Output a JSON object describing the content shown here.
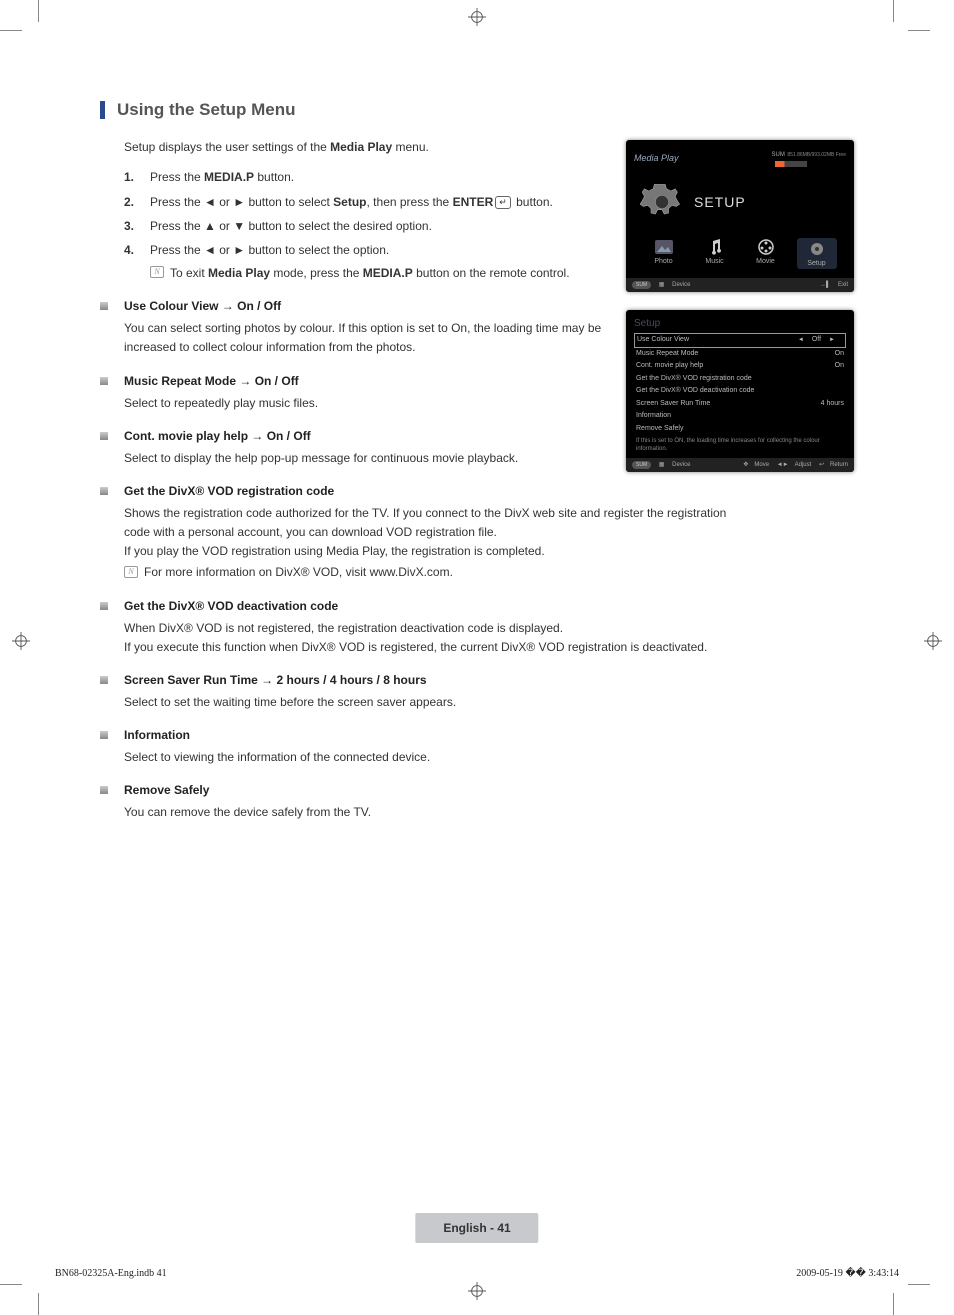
{
  "section_title": "Using the Setup Menu",
  "intro_pre": "Setup displays the user settings of the ",
  "intro_bold": "Media Play",
  "intro_post": " menu.",
  "steps": {
    "s1_num": "1.",
    "s1_a": "Press the ",
    "s1_b": "MEDIA.P",
    "s1_c": " button.",
    "s2_num": "2.",
    "s2_a": "Press the ◄ or ► button to select ",
    "s2_b": "Setup",
    "s2_c": ", then press the ",
    "s2_d": "ENTER",
    "s2_e": " button.",
    "enter_icon": "↵",
    "s3_num": "3.",
    "s3": "Press the ▲ or ▼ button to select the desired option.",
    "s4_num": "4.",
    "s4": "Press the ◄ or ► button to select the option.",
    "s4_note_a": "To exit ",
    "s4_note_b": "Media Play",
    "s4_note_c": " mode, press the ",
    "s4_note_d": "MEDIA.P",
    "s4_note_e": " button on the remote control."
  },
  "items": {
    "i1_title": "Use Colour View → On / Off",
    "i1_desc": "You can select sorting photos by colour. If this option is set to On, the loading time may be increased to collect colour information from the photos.",
    "i2_title": "Music Repeat Mode → On / Off",
    "i2_desc": "Select to repeatedly play music files.",
    "i3_title": "Cont. movie play help → On / Off",
    "i3_desc": "Select to display the help pop-up message for continuous movie playback.",
    "i4_title": "Get the DivX® VOD registration code",
    "i4_desc1": "Shows the registration code authorized for the TV. If you connect to the DivX web site and register the registration code with a personal account, you can download VOD registration file.",
    "i4_desc2": "If you play the VOD registration using Media Play, the registration is completed.",
    "i4_note": "For more information on DivX® VOD, visit www.DivX.com.",
    "i5_title": "Get the DivX® VOD deactivation code",
    "i5_desc1": "When DivX® VOD is not registered, the registration deactivation code is displayed.",
    "i5_desc2": "If you execute this function when DivX® VOD is registered, the current DivX® VOD registration is deactivated.",
    "i6_title": "Screen Saver Run Time → 2 hours / 4 hours / 8 hours",
    "i6_desc": "Select to set the waiting time before the screen saver appears.",
    "i7_title": "Information",
    "i7_desc": "Select to viewing the information of the connected device.",
    "i8_title": "Remove Safely",
    "i8_desc": "You can remove the device safely from the TV."
  },
  "tv1": {
    "title": "Media Play",
    "sum": "SUM",
    "storage": "851.86MB/993.02MB Free",
    "main_label": "SETUP",
    "icons": {
      "photo": "Photo",
      "music": "Music",
      "movie": "Movie",
      "setup": "Setup"
    },
    "footer": {
      "sum": "SUM",
      "device": "Device",
      "exit": "Exit"
    }
  },
  "tv2": {
    "heading": "Setup",
    "rows": [
      {
        "label": "Use Colour View",
        "value": "Off",
        "sel": true,
        "arrows": true
      },
      {
        "label": "Music Repeat Mode",
        "value": "On"
      },
      {
        "label": "Cont. movie play help",
        "value": "On"
      },
      {
        "label": "Get the DivX® VOD registration code",
        "value": ""
      },
      {
        "label": "Get the DivX® VOD deactivation code",
        "value": ""
      },
      {
        "label": "Screen Saver Run Time",
        "value": "4 hours"
      },
      {
        "label": "Information",
        "value": ""
      },
      {
        "label": "Remove Safely",
        "value": ""
      }
    ],
    "note": "If this is set to ON, the loading time increases for collecting the colour information.",
    "footer": {
      "sum": "SUM",
      "device": "Device",
      "move": "Move",
      "adjust": "Adjust",
      "return": "Return"
    }
  },
  "page_label": "English - 41",
  "footer": {
    "left": "BN68-02325A-Eng.indb   41",
    "right": "2009-05-19   �� 3:43:14"
  }
}
